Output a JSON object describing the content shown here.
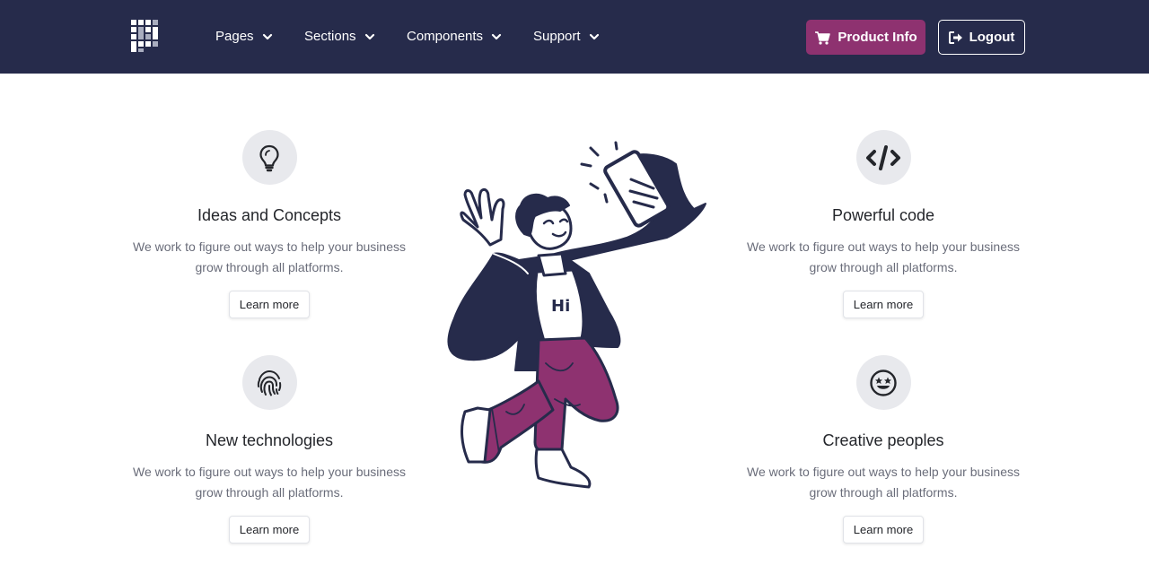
{
  "nav": {
    "items": [
      {
        "label": "Pages"
      },
      {
        "label": "Sections"
      },
      {
        "label": "Components"
      },
      {
        "label": "Support"
      }
    ],
    "product_button": "Product Info",
    "logout_button": "Logout"
  },
  "features": [
    {
      "title": "Ideas and Concepts",
      "text": "We work to figure out ways to help your business grow through all platforms.",
      "button": "Learn more",
      "icon": "lightbulb-icon"
    },
    {
      "title": "New technologies",
      "text": "We work to figure out ways to help your business grow through all platforms.",
      "button": "Learn more",
      "icon": "fingerprint-icon"
    },
    {
      "title": "Powerful code",
      "text": "We work to figure out ways to help your business grow through all platforms.",
      "button": "Learn more",
      "icon": "code-icon"
    },
    {
      "title": "Creative peoples",
      "text": "We work to figure out ways to help your business grow through all platforms.",
      "button": "Learn more",
      "icon": "star-struck-face-icon"
    }
  ],
  "illustration": {
    "shirt_text": "Hi"
  },
  "colors": {
    "navbar": "#262b4b",
    "accent": "#8e3270",
    "icon_bg": "#e8e9ed"
  }
}
